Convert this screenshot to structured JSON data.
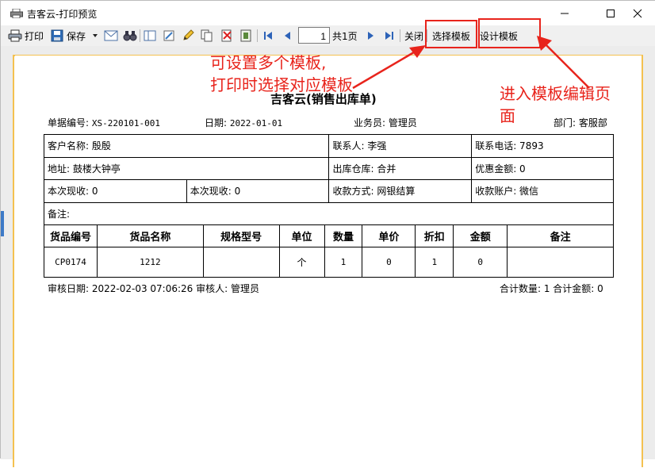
{
  "window": {
    "title": "吉客云-打印预览"
  },
  "toolbar": {
    "print_label": "打印",
    "save_label": "保存",
    "page_value": "1",
    "page_total": "共1页",
    "close_label": "关闭",
    "select_template_label": "选择模板",
    "design_template_label": "设计模板"
  },
  "annotations": {
    "left_line1": "可设置多个模板,",
    "left_line2": "打印时选择对应模板",
    "right_line1": "进入模板编辑页",
    "right_line2": "面",
    "color": "#e8241c"
  },
  "document": {
    "title": "吉客云(销售出库单)",
    "order_label": "单据编号: ",
    "order_no": "XS-220101-001",
    "date_label": "日期: ",
    "date": "2022-01-01",
    "salesperson": "业务员: 管理员",
    "department": "部门: 客服部",
    "info_rows": [
      [
        "客户名称: 殷殷",
        "联系人: 李强",
        "联系电话: 7893"
      ],
      [
        "地址: 鼓楼大钟亭",
        "出库仓库: 合并",
        "优惠金额: 0"
      ],
      [
        "本次现收: 0",
        "本次现收: 0",
        "收款方式: 网银结算",
        "收款账户: 微信"
      ],
      [
        "备注:"
      ]
    ],
    "items_headers": [
      "货品编号",
      "货品名称",
      "规格型号",
      "单位",
      "数量",
      "单价",
      "折扣",
      "金额",
      "备注"
    ],
    "items_rows": [
      [
        "CP0174",
        "1212",
        "",
        "个",
        "1",
        "0",
        "1",
        "0",
        ""
      ]
    ],
    "footer_left": "审核日期: 2022-02-03 07:06:26 审核人: 管理员",
    "footer_right": "合计数量: 1 合计金额: 0"
  }
}
